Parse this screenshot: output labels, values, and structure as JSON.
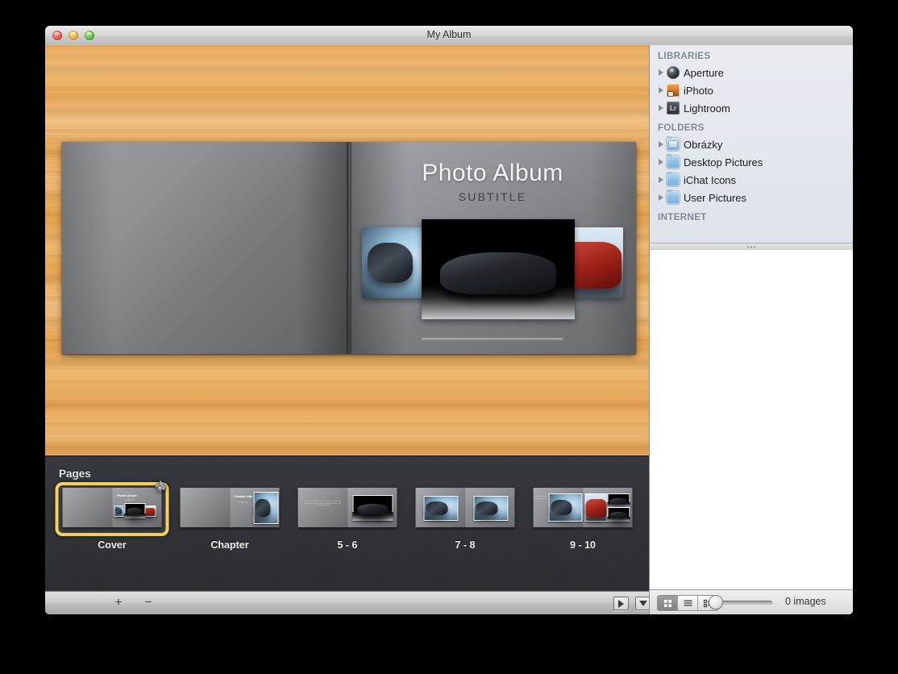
{
  "window": {
    "title": "My Album",
    "traffic_lights": [
      "close-button",
      "minimize-button",
      "zoom-button"
    ]
  },
  "canvas": {
    "cover": {
      "title": "Photo Album",
      "subtitle": "SUBTITLE",
      "photos": [
        "silver-blue-car-photo",
        "black-sports-car-photo",
        "red-sports-car-photo"
      ]
    }
  },
  "pages_panel": {
    "label": "Pages",
    "selected_index": 0,
    "selection_color": "#f2cf5f",
    "items": [
      {
        "caption": "Cover",
        "type": "cover",
        "mini_title": "Photo Album",
        "mini_sub": "SUBTITLE"
      },
      {
        "caption": "Chapter",
        "type": "chapter",
        "mini_title": "Chapter title",
        "mini_sub": "SUBTITLE"
      },
      {
        "caption": "5 - 6",
        "type": "text-photo",
        "mini_text": "Lorem ipsum dolor sit amet consectetur adipiscing elit sed do eiusmod tempor incididunt ut labore et dolore magna aliqua"
      },
      {
        "caption": "7 - 8",
        "type": "two-photo"
      },
      {
        "caption": "9 - 10",
        "type": "multi-photo"
      }
    ],
    "gear_badge": "page-options-gear"
  },
  "bottom_toolbar": {
    "add_label": "+",
    "remove_label": "−",
    "layout_button": "layout-menu-button",
    "play_button": "slideshow-play-button"
  },
  "sidebar": {
    "sections": [
      {
        "header": "LIBRARIES",
        "items": [
          {
            "label": "Aperture",
            "icon": "aperture-icon"
          },
          {
            "label": "iPhoto",
            "icon": "iphoto-icon"
          },
          {
            "label": "Lightroom",
            "icon": "lightroom-icon",
            "badge": "Lr"
          }
        ]
      },
      {
        "header": "FOLDERS",
        "items": [
          {
            "label": "Obrázky",
            "icon": "pictures-folder-icon"
          },
          {
            "label": "Desktop Pictures",
            "icon": "folder-icon"
          },
          {
            "label": "iChat Icons",
            "icon": "folder-icon"
          },
          {
            "label": "User Pictures",
            "icon": "folder-icon"
          }
        ]
      },
      {
        "header": "INTERNET",
        "items": []
      }
    ]
  },
  "status_bar": {
    "view_modes": [
      "grid-view",
      "list-view",
      "detail-view"
    ],
    "active_view_mode": "grid-view",
    "zoom_value": 0,
    "image_count": "0 images"
  }
}
